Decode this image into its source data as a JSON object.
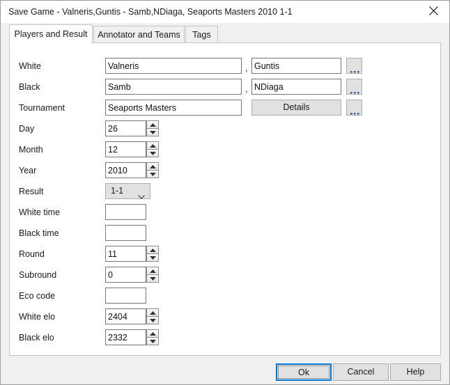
{
  "window": {
    "title": "Save Game - Valneris,Guntis - Samb,NDiaga, Seaports Masters 2010 1-1",
    "close_icon": "close-icon"
  },
  "tabs": [
    {
      "label": "Players and Result",
      "active": true
    },
    {
      "label": "Annotator and Teams",
      "active": false
    },
    {
      "label": "Tags",
      "active": false
    }
  ],
  "form": {
    "separator": ",",
    "browse_label": "...",
    "rows": [
      {
        "label": "White",
        "value": "Valneris",
        "value2": "Guntis"
      },
      {
        "label": "Black",
        "value": "Samb",
        "value2": "NDiaga"
      },
      {
        "label": "Tournament",
        "value": "Seaports Masters",
        "details_label": "Details"
      },
      {
        "label": "Day",
        "value": "26"
      },
      {
        "label": "Month",
        "value": "12"
      },
      {
        "label": "Year",
        "value": "2010"
      },
      {
        "label": "Result",
        "value": "1-1",
        "options": [
          "1-1"
        ]
      },
      {
        "label": "White time",
        "value": ""
      },
      {
        "label": "Black time",
        "value": ""
      },
      {
        "label": "Round",
        "value": "11"
      },
      {
        "label": "Subround",
        "value": "0"
      },
      {
        "label": "Eco code",
        "value": ""
      },
      {
        "label": "White elo",
        "value": "2404"
      },
      {
        "label": "Black elo",
        "value": "2332"
      }
    ]
  },
  "footer": {
    "ok_label": "Ok",
    "cancel_label": "Cancel",
    "help_label": "Help"
  },
  "colors": {
    "accent": "#0078d7",
    "window_bg": "#f0f0f0",
    "panel_bg": "#ffffff",
    "border": "#c6c6c6"
  }
}
